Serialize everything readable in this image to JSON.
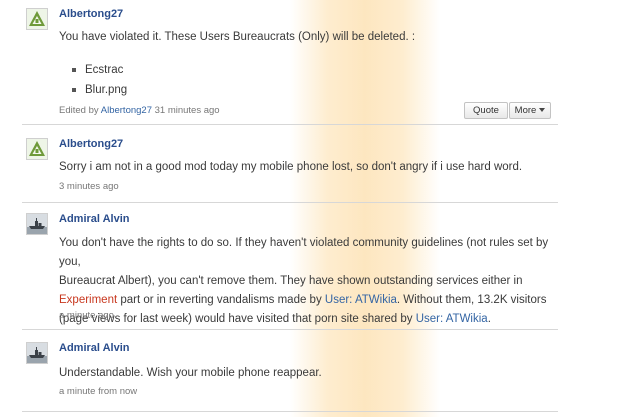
{
  "posts": [
    {
      "username": "Albertong27",
      "body": "You have violated it. These Users Bureaucrats (Only) will be deleted. :",
      "files": [
        "Ecstrac",
        "Blur.png"
      ],
      "edited_prefix": "Edited by",
      "edited_by": "Albertong27",
      "time": "31 minutes ago",
      "quote_label": "Quote",
      "more_label": "More"
    },
    {
      "username": "Albertong27",
      "body": "Sorry i am not in a good mod today my mobile phone lost, so don't angry if i use hard word.",
      "time": "3 minutes ago"
    },
    {
      "username": "Admiral Alvin",
      "line1": "You don't have the rights to do so. If they haven't violated community guidelines (not rules set by you,",
      "line2": "Bureaucrat Albert), you can't remove them. They have shown outstanding services either in",
      "line3_link": "Experiment",
      "line3_mid": " part or in reverting vandalisms made by ",
      "line3_link2": "User: ATWikia",
      "line3_end": ". Without them, 13.2K visitors",
      "line4_start": "(page views for last week) would have visited that porn site shared by ",
      "line4_link": "User: ATWikia",
      "line4_end": ".",
      "time": "a minute ago"
    },
    {
      "username": "Admiral Alvin",
      "body": "Understandable. Wish your mobile phone reappear.",
      "time": "a minute from now"
    }
  ]
}
